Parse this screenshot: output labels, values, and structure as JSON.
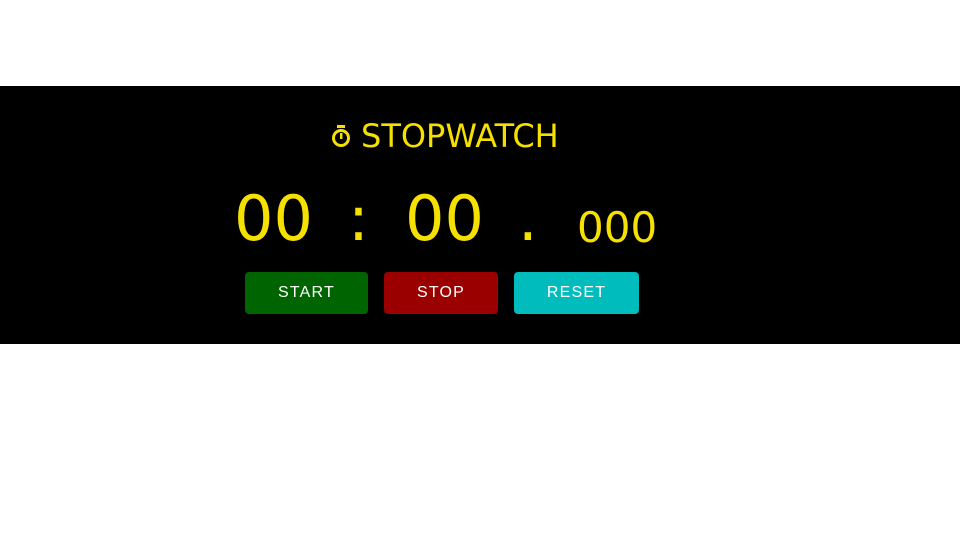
{
  "app": {
    "title": "STOPWATCH",
    "icon": "stopwatch-icon"
  },
  "display": {
    "minutes": "00",
    "colon": ":",
    "seconds": "00",
    "dot": ".",
    "milliseconds": "000"
  },
  "controls": {
    "start_label": "START",
    "stop_label": "STOP",
    "reset_label": "RESET"
  },
  "colors": {
    "background_band": "#000000",
    "text_accent": "#f5e000",
    "start": "#006400",
    "stop": "#9b0000",
    "reset": "#00bcbc"
  }
}
